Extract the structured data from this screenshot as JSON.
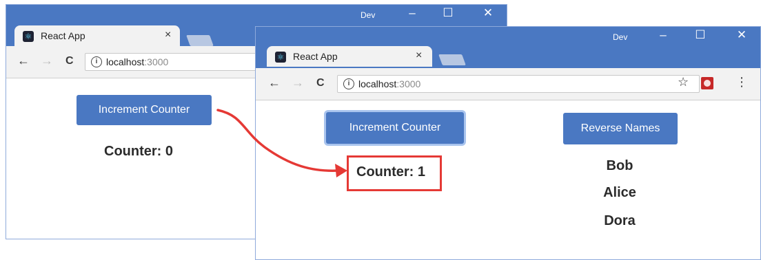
{
  "before": {
    "tab": {
      "title": "React App",
      "close": "×"
    },
    "window_label": "Dev",
    "controls": {
      "minimize": "–",
      "maximize": "☐",
      "close": "✕"
    },
    "nav": {
      "back": "←",
      "forward": "→",
      "reload": "C"
    },
    "address": {
      "info": "i",
      "host": "localhost",
      "port": ":3000"
    },
    "button_label": "Increment Counter",
    "counter_text": "Counter: 0"
  },
  "after": {
    "tab": {
      "title": "React App",
      "close": "×"
    },
    "window_label": "Dev",
    "controls": {
      "minimize": "–",
      "maximize": "☐",
      "close": "✕"
    },
    "nav": {
      "back": "←",
      "forward": "→",
      "reload": "C"
    },
    "address": {
      "info": "i",
      "host": "localhost",
      "port": ":3000"
    },
    "toolbar_icons": {
      "star": "☆",
      "menu": "⋮"
    },
    "increment_label": "Increment Counter",
    "counter_text": "Counter: 1",
    "reverse_label": "Reverse Names",
    "names": [
      "Bob",
      "Alice",
      "Dora"
    ]
  },
  "colors": {
    "titlebar": "#4a78c2",
    "button": "#4a78c2",
    "highlight": "#e53935"
  }
}
